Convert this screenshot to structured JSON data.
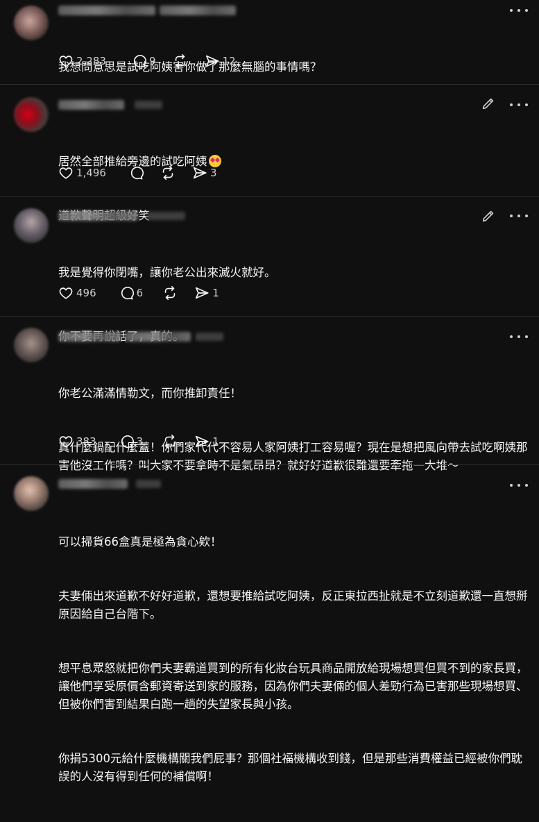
{
  "posts": [
    {
      "lines": [
        "我想問意思是試吃阿姨害你做了那麼無腦的事情嗎？"
      ],
      "likes": "2,283",
      "comments": "9",
      "reposts": "",
      "shares": "12",
      "editable": false,
      "emoji": false
    },
    {
      "lines": [
        "居然全部推給旁邊的試吃阿姨",
        "道歉聲明超級好笑"
      ],
      "likes": "1,496",
      "comments": "",
      "reposts": "",
      "shares": "3",
      "editable": true,
      "emoji": true
    },
    {
      "lines": [
        "我是覺得你閉嘴，讓你老公出來滅火就好。",
        "你不要再說話了，真的。"
      ],
      "likes": "496",
      "comments": "6",
      "reposts": "",
      "shares": "1",
      "editable": true,
      "emoji": false
    },
    {
      "lines": [
        "你老公滿滿情勒文，而你推卸責任！",
        "真什麼鍋配什麼蓋！你們家代代不容易人家阿姨打工容易喔？現在是想把風向帶去試吃啊姨那害他沒工作嗎？叫大家不要拿時不是氣昂昂？就好好道歉很難還要牽拖一大堆～"
      ],
      "likes": "383",
      "comments": "3",
      "reposts": "",
      "shares": "1",
      "editable": false,
      "emoji": false
    },
    {
      "lines": [
        "可以掃貨66盒真是極為貪心欸！",
        "夫妻倆出來道歉不好好道歉，還想要推給試吃阿姨，反正東拉西扯就是不立刻道歉還一直想掰原因給自己台階下。",
        "想平息眾怒就把你們夫妻霸道買到的所有化妝台玩具商品開放給現場想買但買不到的家長買，讓他們享受原價含郵資寄送到家的服務，因為你們夫妻倆的個人差勁行為已害那些現場想買、但被你們害到結果白跑一趟的失望家長與小孩。",
        "你捐5300元給什麼機構關我們屁事？那個社福機構收到錢，但是那些消費權益已經被你們耽誤的人沒有得到任何的補償啊！"
      ],
      "likes": "",
      "comments": "",
      "reposts": "",
      "shares": "",
      "editable": false,
      "emoji": false
    }
  ],
  "colors": {
    "background": "#101010",
    "text": "#f3f5f7",
    "muted": "#cfcfcf",
    "divider": "#2d2d2d"
  },
  "icons": {
    "like": "heart-icon",
    "comment": "comment-bubble-icon",
    "repost": "repost-icon",
    "share": "send-icon",
    "more": "more-dots-icon",
    "edit": "pencil-icon"
  }
}
